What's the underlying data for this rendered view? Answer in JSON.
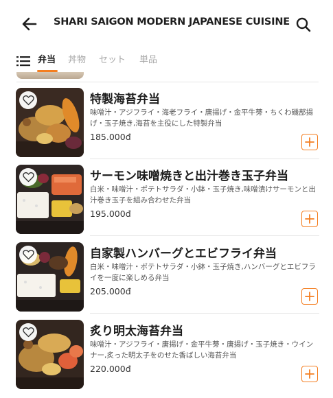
{
  "header": {
    "back_icon": "arrow-left-icon",
    "title": "SHARI SAIGON MODERN JAPANESE CUISINE",
    "search_icon": "search-icon"
  },
  "tabs": {
    "menu_icon": "list-menu-icon",
    "items": [
      {
        "label": "弁当",
        "active": true
      },
      {
        "label": "丼物",
        "active": false
      },
      {
        "label": "セット",
        "active": false
      },
      {
        "label": "単品",
        "active": false
      }
    ]
  },
  "colors": {
    "accent": "#f47e20",
    "text": "#1e1e1e",
    "muted": "#a6a6a6"
  },
  "items": [
    {
      "name": "特製海苔弁当",
      "description": "味噌汁・アジフライ・海老フライ・唐揚げ・金平牛蒡・ちくわ磯部揚げ・玉子焼き,海苔を主役にした特製弁当",
      "price": "185.000đ"
    },
    {
      "name": "サーモン味噌焼きと出汁巻き玉子弁当",
      "description": "白米・味噌汁・ポテトサラダ・小鉢・玉子焼き,味噌漬けサーモンと出汁巻き玉子を組み合わせた弁当",
      "price": "195.000đ"
    },
    {
      "name": "自家製ハンバーグとエビフライ弁当",
      "description": "白米・味噌汁・ポテトサラダ・小鉢・玉子焼き,ハンバーグとエビフライを一度に楽しめる弁当",
      "price": "205.000đ"
    },
    {
      "name": "炙り明太海苔弁当",
      "description": "味噌汁・アジフライ・唐揚げ・金平牛蒡・唐揚げ・玉子焼き・ウインナー,炙った明太子をのせた香ばしい海苔弁当",
      "price": "220.000đ"
    }
  ]
}
